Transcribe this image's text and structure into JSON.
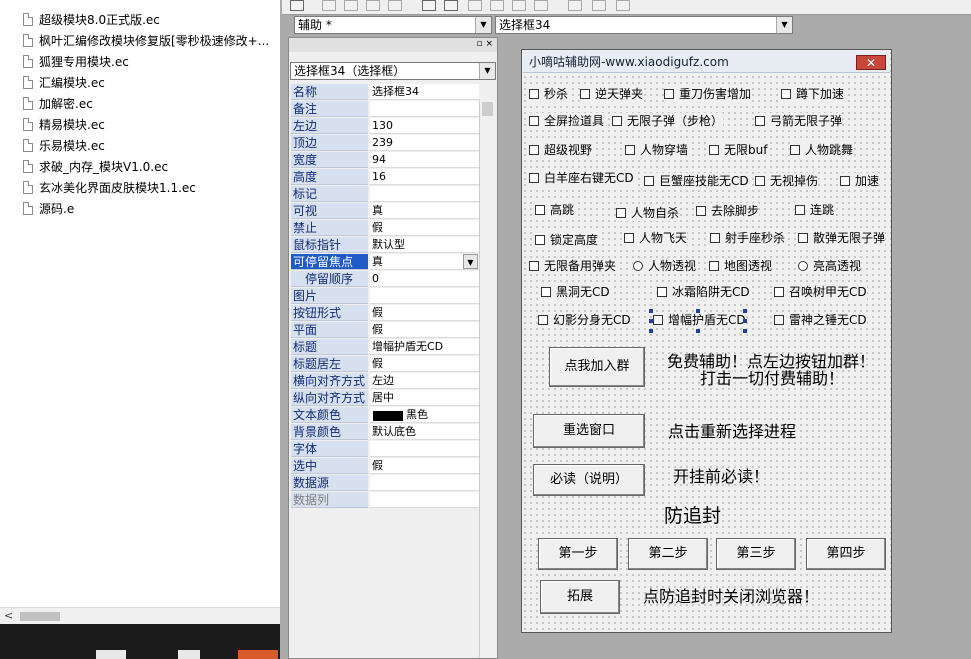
{
  "file_list": [
    "超级模块8.0正式版.ec",
    "枫叶汇编修改模块修复版[零秒极速修改+...",
    "狐狸专用模块.ec",
    "汇编模块.ec",
    "加解密.ec",
    "精易模块.ec",
    "乐易模块.ec",
    "求破_内存_模块V1.0.ec",
    "玄冰美化界面皮肤模块1.1.ec",
    "源码.e"
  ],
  "toolbar": {
    "form_combo": "辅助 *",
    "control_combo": "选择框34"
  },
  "property_panel": {
    "selector": "选择框34（选择框）",
    "header_buttons": "▫ ×",
    "rows": [
      {
        "name": "名称",
        "value": "选择框34"
      },
      {
        "name": "备注",
        "value": ""
      },
      {
        "name": "左边",
        "value": "130"
      },
      {
        "name": "顶边",
        "value": "239"
      },
      {
        "name": "宽度",
        "value": "94"
      },
      {
        "name": "高度",
        "value": "16"
      },
      {
        "name": "标记",
        "value": ""
      },
      {
        "name": "可视",
        "value": "真"
      },
      {
        "name": "禁止",
        "value": "假"
      },
      {
        "name": "鼠标指针",
        "value": "默认型"
      },
      {
        "name": "可停留焦点",
        "value": "真"
      },
      {
        "name": "停留顺序",
        "value": "0"
      },
      {
        "name": "图片",
        "value": ""
      },
      {
        "name": "按钮形式",
        "value": "假"
      },
      {
        "name": "平面",
        "value": "假"
      },
      {
        "name": "标题",
        "value": "增幅护盾无CD"
      },
      {
        "name": "标题居左",
        "value": "假"
      },
      {
        "name": "横向对齐方式",
        "value": "左边"
      },
      {
        "name": "纵向对齐方式",
        "value": "居中"
      },
      {
        "name": "文本颜色",
        "value": "黑色"
      },
      {
        "name": "背景颜色",
        "value": "默认底色"
      },
      {
        "name": "字体",
        "value": ""
      },
      {
        "name": "选中",
        "value": "假"
      },
      {
        "name": "数据源",
        "value": ""
      },
      {
        "name": "数据列",
        "value": ""
      }
    ]
  },
  "form": {
    "title": "小嘀咕辅助网-www.xiaodigufz.com",
    "close_label": "✕",
    "options": [
      "秒杀",
      "逆天弹夹",
      "重刀伤害增加",
      "蹲下加速",
      "全屏捡道具",
      "无限子弹（步枪）",
      "弓箭无限子弹",
      "超级视野",
      "人物穿墙",
      "无限buf",
      "人物跳舞",
      "白羊座右键无CD",
      "巨蟹座技能无CD",
      "无视掉伤",
      "加速",
      "高跳",
      "人物自杀",
      "去除脚步",
      "连跳",
      "锁定高度",
      "人物飞天",
      "射手座秒杀",
      "散弹无限子弹",
      "无限备用弹夹",
      "人物透视",
      "地图透视",
      "亮高透视",
      "黑洞无CD",
      "冰霜陷阱无CD",
      "召唤树甲无CD",
      "幻影分身无CD",
      "增幅护盾无CD",
      "雷神之锤无CD"
    ],
    "buttons": {
      "join_group": "点我加入群",
      "reselect_window": "重选窗口",
      "must_read": "必读（说明）",
      "step1": "第一步",
      "step2": "第二步",
      "step3": "第三步",
      "step4": "第四步",
      "expand": "拓展"
    },
    "labels": {
      "free_line1": "免费辅助！点左边按钮加群！",
      "free_line2": "打击一切付费辅助！",
      "reselect_hint": "点击重新选择进程",
      "read_first": "开挂前必读！",
      "anti_ban": "防追封",
      "close_browser": "点防追封时关闭浏览器！"
    }
  },
  "colors": {
    "selected_row": "#1e5bc7",
    "prop_name_bg": "#d7e0ef",
    "close_button": "#c9463b"
  }
}
